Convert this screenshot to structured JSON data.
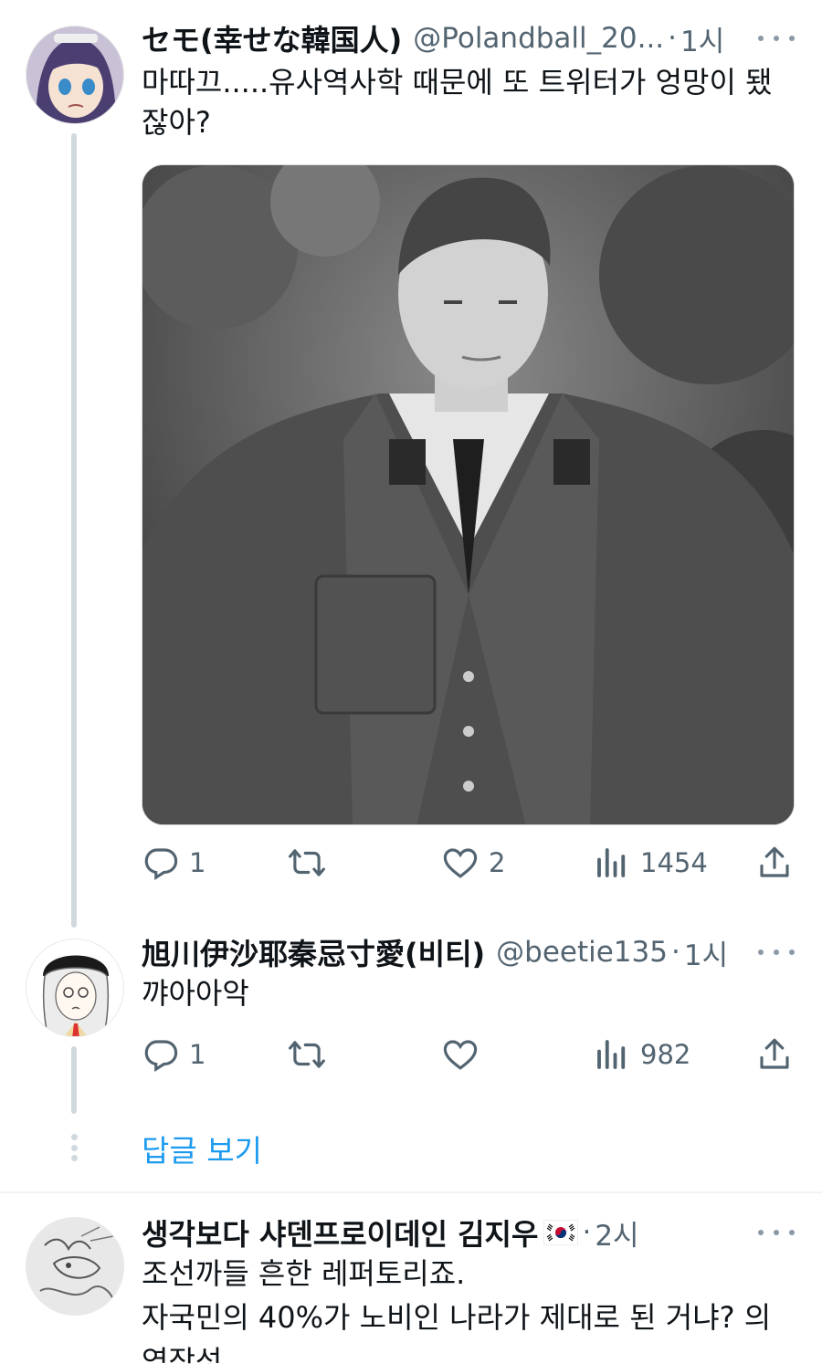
{
  "tweets": [
    {
      "name": "セモ(幸せな韓国人)",
      "handle": "@Polandball_20...",
      "separator": "·",
      "time": "1시",
      "text": "마따끄.....유사역사학 때문에 또 트위터가 엉망이 됐잖아?",
      "image_alt": "black-and-white portrait photo of a uniformed man",
      "replies": "1",
      "retweets": "",
      "likes": "2",
      "views": "1454"
    },
    {
      "name": "旭川伊沙耶秦忌寸愛(비티)",
      "handle": "@beetie135",
      "separator": "·",
      "time": "1시",
      "text": "꺄아아악",
      "replies": "1",
      "retweets": "",
      "likes": "",
      "views": "982"
    },
    {
      "name": "생각보다 샤덴프로이데인 김지우",
      "flag": "south-korea-flag",
      "separator": "·",
      "time": "2시",
      "text_line1": "조선까들 흔한 레퍼토리죠.",
      "text_line2": "자국민의 40%가 노비인 나라가 제대로 된 거냐? 의",
      "text_line3": "역작성"
    }
  ],
  "show_replies": "답글 보기",
  "icons": [
    "reply-icon",
    "retweet-icon",
    "like-icon",
    "views-icon",
    "share-icon",
    "more-icon"
  ],
  "colors": {
    "link": "#1d9bf0",
    "muted": "#536471",
    "text": "#0f1419",
    "thread_line": "#cfd9de"
  }
}
